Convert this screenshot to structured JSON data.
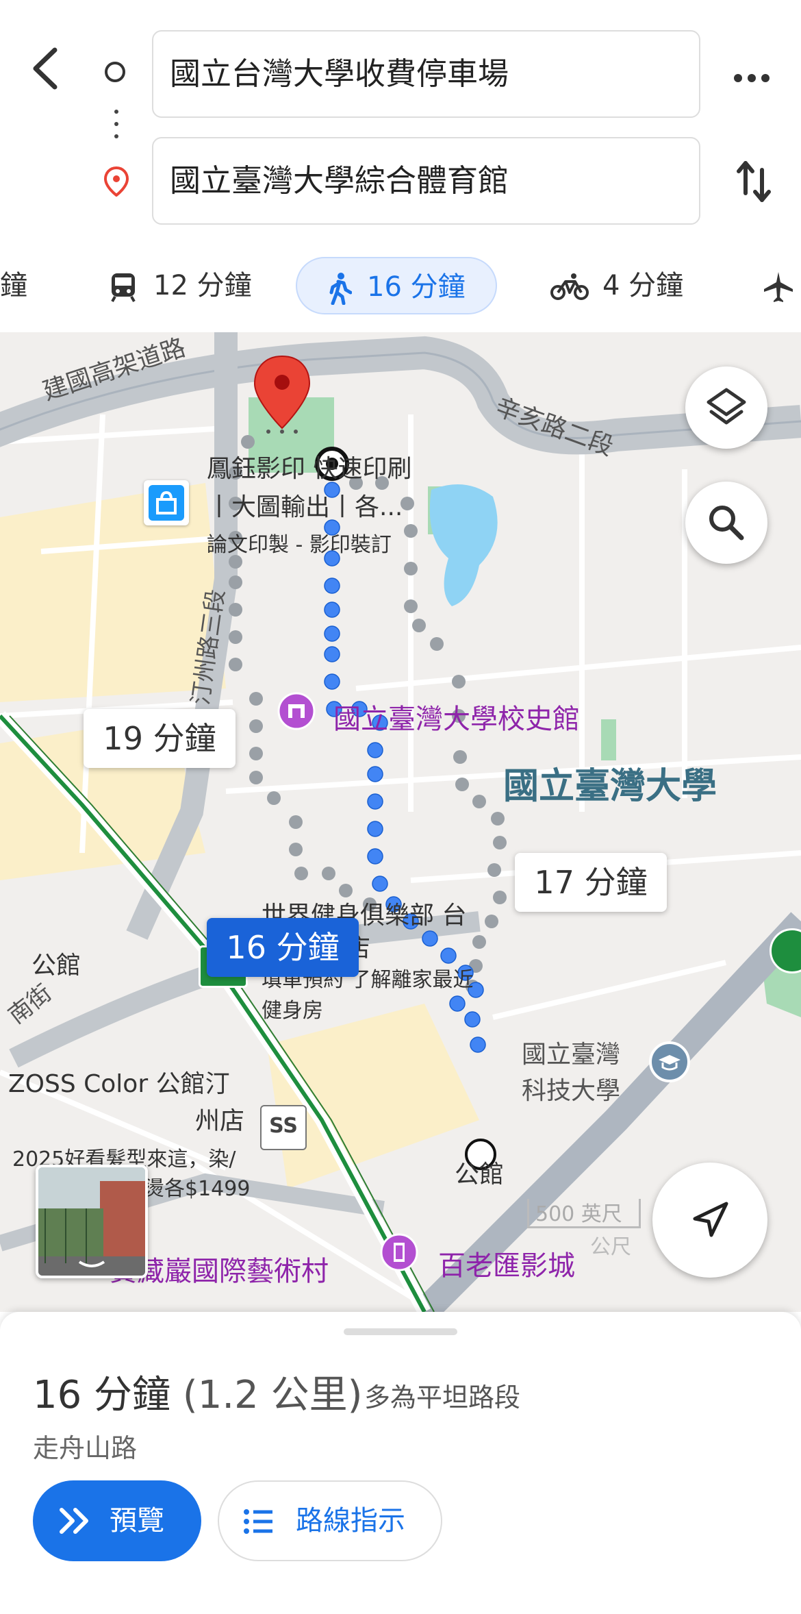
{
  "header": {
    "origin": "國立台灣大學收費停車場",
    "destination": "國立臺灣大學綜合體育館",
    "back_icon": "back-arrow-icon",
    "more_icon": "more-horizontal-icon",
    "swap_icon": "swap-vertical-icon"
  },
  "modes": [
    {
      "label": "鐘",
      "icon": "car-icon"
    },
    {
      "label": "12 分鐘",
      "icon": "transit-icon"
    },
    {
      "label": "16 分鐘",
      "icon": "walk-icon",
      "active": true
    },
    {
      "label": "4 分鐘",
      "icon": "bike-icon"
    },
    {
      "label": "",
      "icon": "flight-icon"
    }
  ],
  "map": {
    "roads": {
      "jianguo": "建國高架道路",
      "xinhai": "辛亥路二段",
      "tingzhou": "汀州路三段",
      "guting_street": "南街",
      "gongguan_left": "公館",
      "gongguan_bottom": "公館"
    },
    "places": {
      "print_shop_l1": "鳳鈺影印 快速印刷",
      "print_shop_l2": "丨大圖輸出丨各...",
      "print_shop_l3": "論文印製 - 影印裝訂",
      "history_museum": "國立臺灣大學校史館",
      "ntu": "國立臺灣大學",
      "gym_l1": "世界健身俱樂部 台",
      "gym_l2": "店",
      "gym_l3": "填單預約 了解離家最近",
      "gym_l4": "健身房",
      "ntust_l1": "國立臺灣",
      "ntust_l2": "科技大學",
      "zoss_l1": "ZOSS Color 公館汀",
      "zoss_l2": "州店",
      "zoss_l3": "2025好看髮型來這，染/",
      "zoss_l4": "燙各$1499",
      "treasure_hill": "寶藏巖國際藝術村",
      "cinema": "百老匯影城"
    },
    "time_labels": {
      "alt1": "19 分鐘",
      "alt2": "17 分鐘",
      "selected": "16 分鐘"
    },
    "scale": {
      "imperial": "500 英尺",
      "metric": "公尺"
    },
    "colors": {
      "route_selected": "#4285f4",
      "route_alt": "#9aa0a6",
      "pin": "#ea4335",
      "accent": "#1a73e8"
    }
  },
  "sheet": {
    "time": "16 分鐘",
    "distance": "(1.2 公里)",
    "note": "多為平坦路段",
    "via": "走舟山路",
    "preview_label": "預覽",
    "steps_label": "路線指示"
  }
}
